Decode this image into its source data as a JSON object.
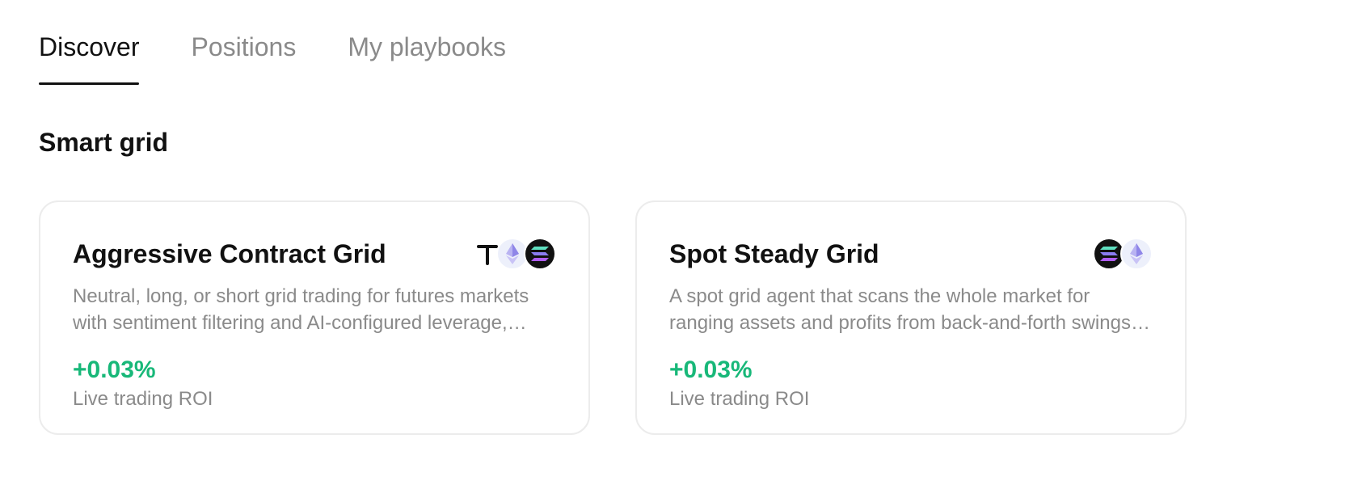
{
  "tabs": [
    {
      "label": "Discover",
      "active": true
    },
    {
      "label": "Positions",
      "active": false
    },
    {
      "label": "My playbooks",
      "active": false
    }
  ],
  "section": {
    "title": "Smart grid"
  },
  "cards": [
    {
      "title": "Aggressive Contract Grid",
      "description": "Neutral, long, or short grid trading for futures markets with sentiment filtering and AI-configured leverage, range and grid count.",
      "roi": "+0.03%",
      "roi_label": "Live trading ROI",
      "coins": [
        "ton-icon",
        "eth-icon",
        "sol-icon"
      ]
    },
    {
      "title": "Spot Steady Grid",
      "description": "A spot grid agent that scans the whole market for ranging assets and profits from back-and-forth swings in price.",
      "roi": "+0.03%",
      "roi_label": "Live trading ROI",
      "coins": [
        "sol-icon",
        "eth-icon"
      ]
    }
  ],
  "colors": {
    "roi_positive": "#18b879",
    "muted_text": "#8a8a8a",
    "active_tab": "#111111"
  }
}
